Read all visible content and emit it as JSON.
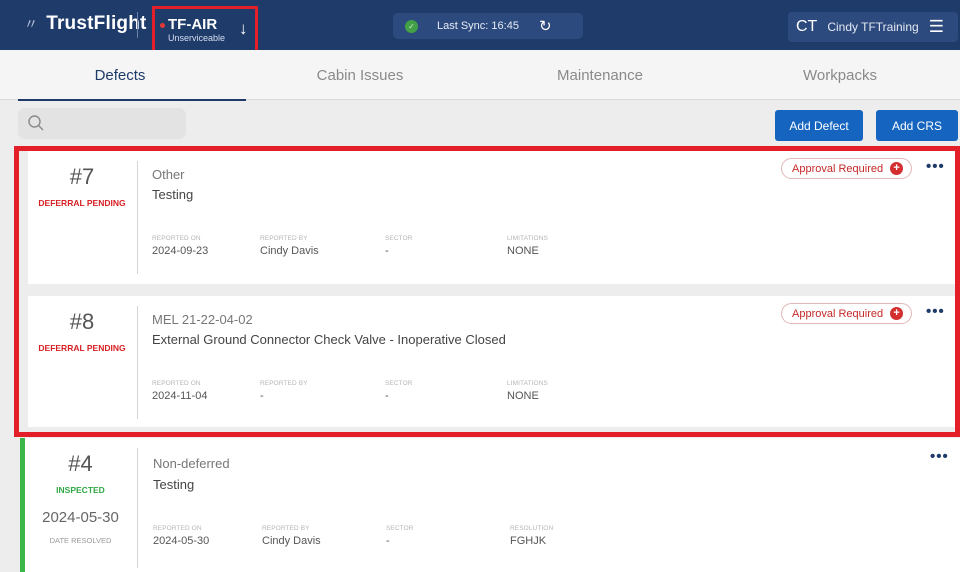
{
  "header": {
    "logo_text": "TrustFlight",
    "logo_mark": "〃",
    "aircraft": {
      "registration": "TF-AIR",
      "status": "Unserviceable",
      "arrow_icon": "↓"
    },
    "sync": {
      "label": "Last Sync: 16:45",
      "check_icon": "✓",
      "refresh_icon": "↻"
    },
    "user": {
      "initials": "CT",
      "name": "Cindy  TFTraining",
      "menu_icon": "☰"
    }
  },
  "tabs": [
    {
      "label": "Defects",
      "active": true
    },
    {
      "label": "Cabin Issues",
      "active": false
    },
    {
      "label": "Maintenance",
      "active": false
    },
    {
      "label": "Workpacks",
      "active": false
    }
  ],
  "toolbar": {
    "search_placeholder": "",
    "add_defect": "Add Defect",
    "add_crs": "Add CRS"
  },
  "defects": [
    {
      "number": "#7",
      "status": "DEFERRAL PENDING",
      "category": "Other",
      "title": "Testing",
      "badge": "Approval Required",
      "badge_icon": "+",
      "more_icon": "•••",
      "meta": [
        {
          "label": "REPORTED ON",
          "value": "2024-09-23"
        },
        {
          "label": "REPORTED BY",
          "value": "Cindy Davis"
        },
        {
          "label": "SECTOR",
          "value": "-"
        },
        {
          "label": "LIMITATIONS",
          "value": "NONE"
        }
      ]
    },
    {
      "number": "#8",
      "status": "DEFERRAL PENDING",
      "category": "MEL  21-22-04-02",
      "title": "External Ground Connector Check Valve - Inoperative Closed",
      "badge": "Approval Required",
      "badge_icon": "+",
      "more_icon": "•••",
      "meta": [
        {
          "label": "REPORTED ON",
          "value": "2024-11-04"
        },
        {
          "label": "REPORTED BY",
          "value": "-"
        },
        {
          "label": "SECTOR",
          "value": "-"
        },
        {
          "label": "LIMITATIONS",
          "value": "NONE"
        }
      ]
    },
    {
      "number": "#4",
      "status": "INSPECTED",
      "date": "2024-05-30",
      "date_label": "DATE RESOLVED",
      "category": "Non-deferred",
      "title": "Testing",
      "more_icon": "•••",
      "meta": [
        {
          "label": "REPORTED ON",
          "value": "2024-05-30"
        },
        {
          "label": "REPORTED BY",
          "value": "Cindy Davis"
        },
        {
          "label": "SECTOR",
          "value": "-"
        },
        {
          "label": "RESOLUTION",
          "value": "FGHJK"
        }
      ]
    }
  ],
  "colors": {
    "header_bg": "#1f3b6a",
    "accent_blue": "#1565c0",
    "highlight_red": "#e3202a",
    "pending_red": "#d62024",
    "inspected_green": "#31a745"
  }
}
